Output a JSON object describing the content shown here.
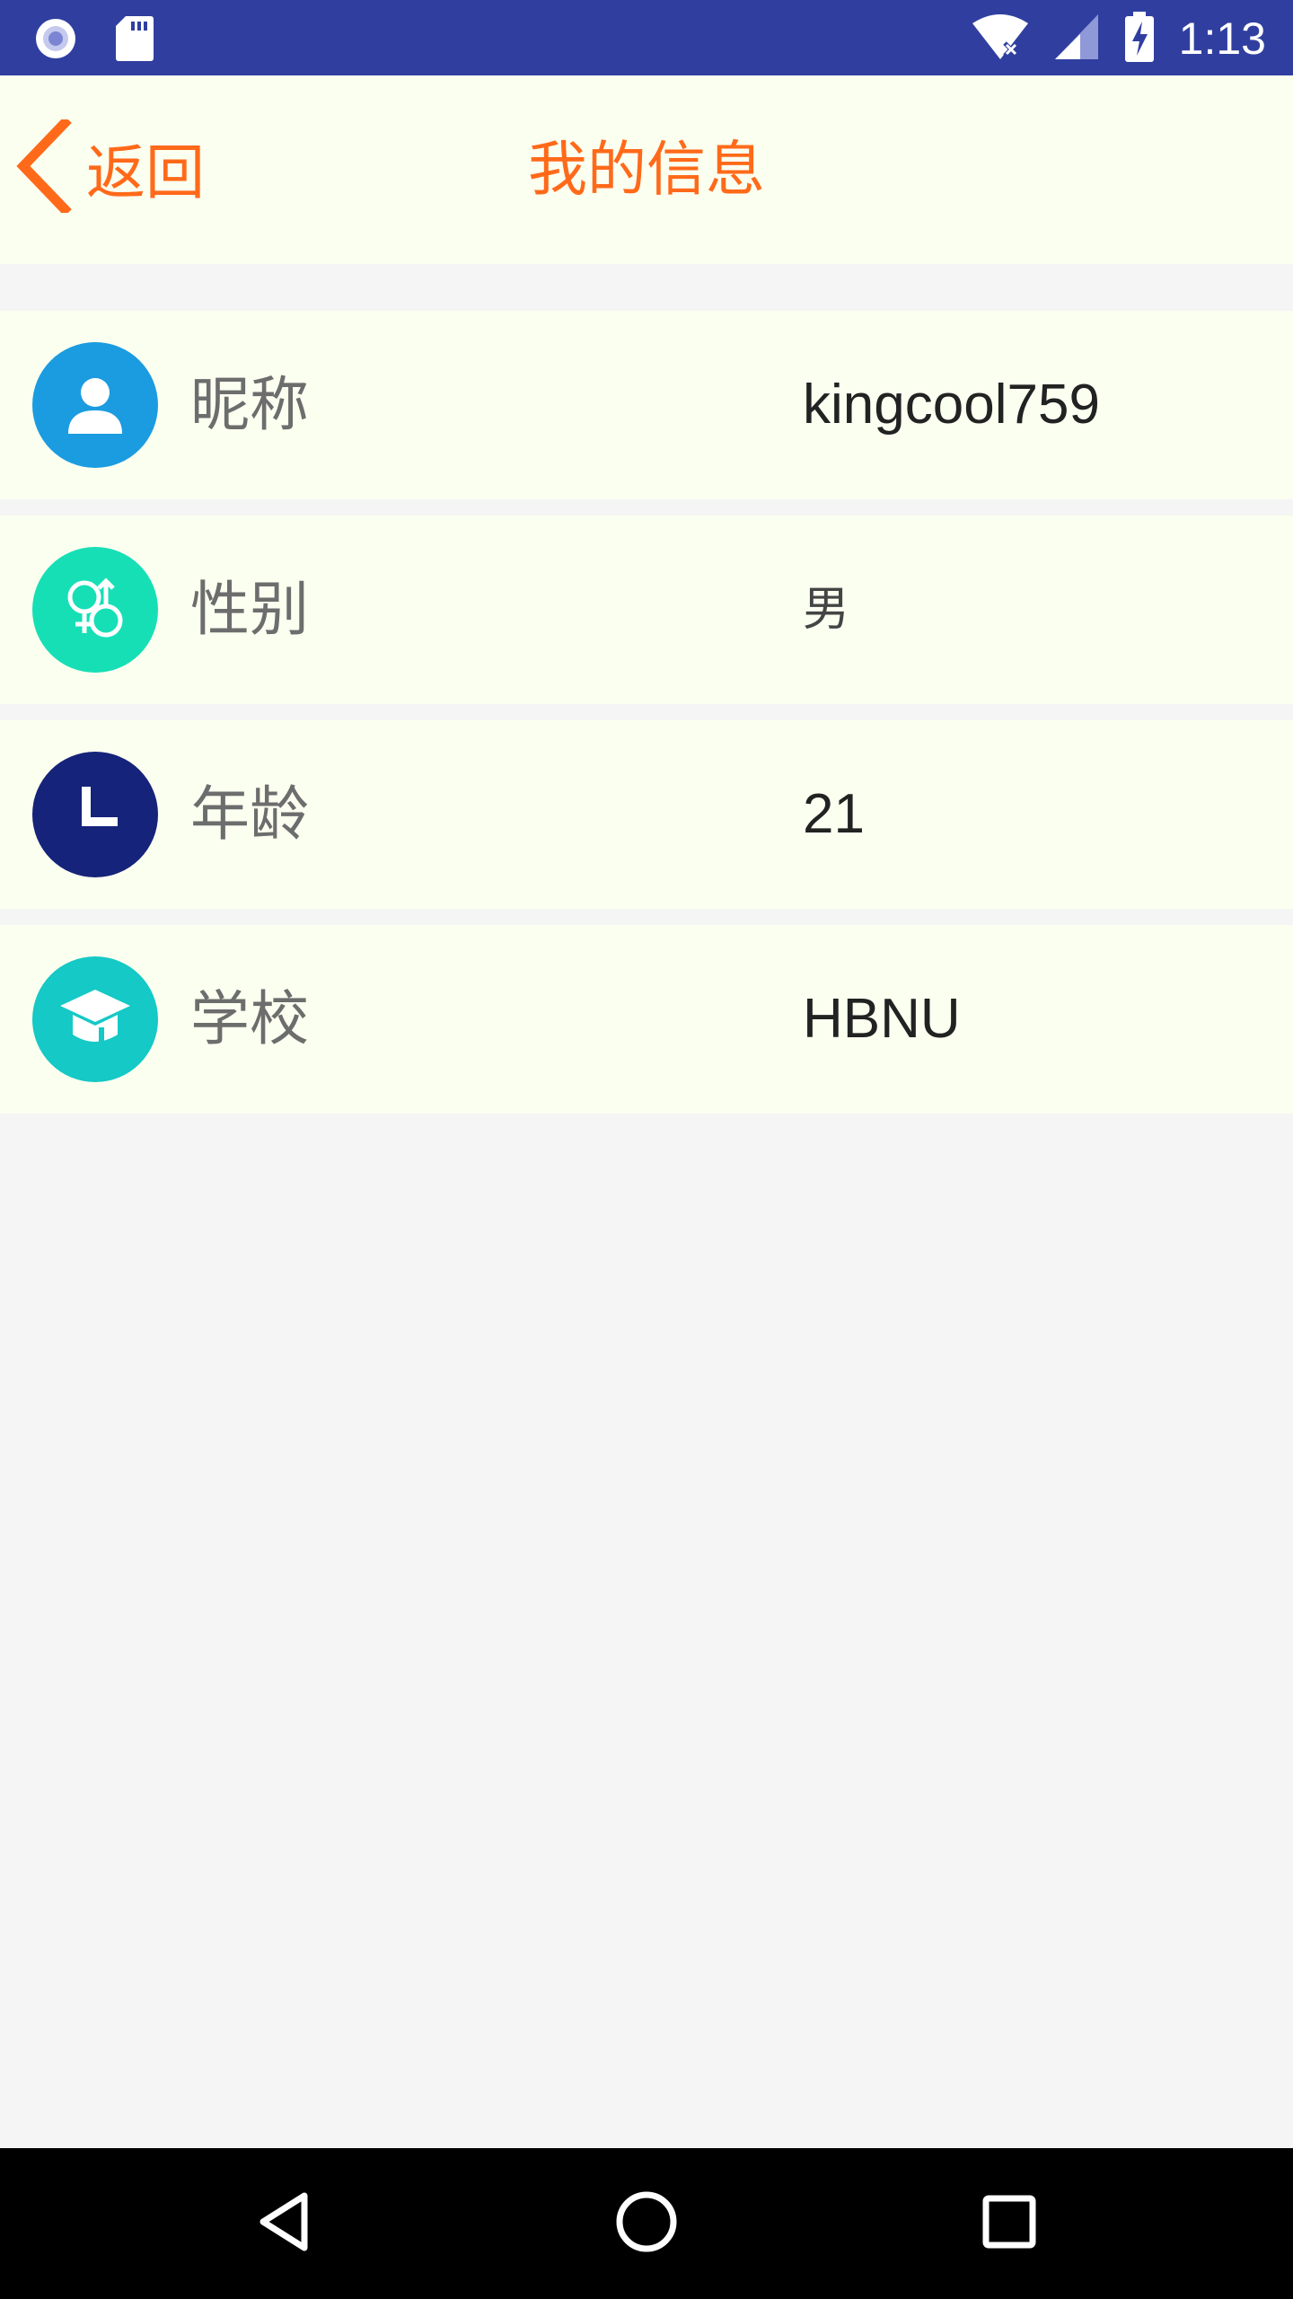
{
  "status_bar": {
    "time": "1:13",
    "icons": [
      "sync-icon",
      "sd-card-icon",
      "wifi-icon",
      "signal-icon",
      "battery-charging-icon"
    ]
  },
  "header": {
    "back_label": "返回",
    "title": "我的信息"
  },
  "rows": [
    {
      "label": "昵称",
      "value": "kingcool759",
      "icon": "user-icon",
      "color": "#1b9ce0"
    },
    {
      "label": "性别",
      "value": "男",
      "icon": "gender-icon",
      "color": "#16dfb6"
    },
    {
      "label": "年龄",
      "value": "21",
      "icon": "clock-icon",
      "color": "#15237a"
    },
    {
      "label": "学校",
      "value": "HBNU",
      "icon": "graduation-cap-icon",
      "color": "#14c9c6"
    }
  ],
  "colors": {
    "status_bar": "#303f9f",
    "accent": "#ff6a1a",
    "row_background": "#fbfff0",
    "page_background": "#f5f5f5"
  },
  "nav_bar": {
    "buttons": [
      "back-triangle-icon",
      "home-circle-icon",
      "recents-square-icon"
    ]
  }
}
